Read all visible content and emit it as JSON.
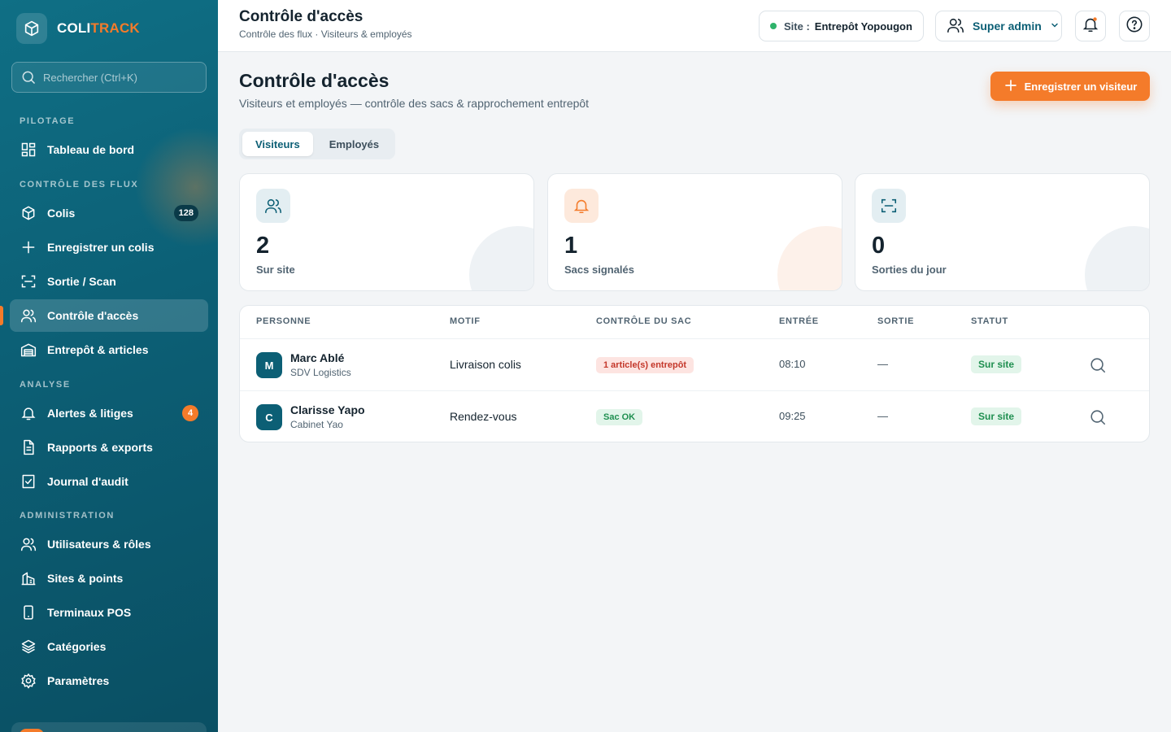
{
  "brand": {
    "part1": "COLI",
    "part2": "TRACK",
    "accent_color": "#f47b2a"
  },
  "search": {
    "placeholder": "Rechercher (Ctrl+K)"
  },
  "sidebar": {
    "sections": [
      "PILOTAGE",
      "CONTRÔLE DES FLUX",
      "ANALYSE",
      "ADMINISTRATION"
    ],
    "items": [
      {
        "label": "Tableau de bord",
        "icon": "dashboard-icon"
      },
      {
        "label": "Colis",
        "icon": "package-icon",
        "badge": "128"
      },
      {
        "label": "Enregistrer un colis",
        "icon": "plus-icon"
      },
      {
        "label": "Sortie / Scan",
        "icon": "scan-icon"
      },
      {
        "label": "Contrôle d'accès",
        "icon": "users-icon",
        "active": true
      },
      {
        "label": "Entrepôt & articles",
        "icon": "warehouse-icon"
      },
      {
        "label": "Alertes & litiges",
        "icon": "bell-icon",
        "badge": "4"
      },
      {
        "label": "Rapports & exports",
        "icon": "document-icon"
      },
      {
        "label": "Journal d'audit",
        "icon": "checklist-icon"
      },
      {
        "label": "Utilisateurs & rôles",
        "icon": "users-icon"
      },
      {
        "label": "Sites & points",
        "icon": "building-icon"
      },
      {
        "label": "Terminaux POS",
        "icon": "device-icon"
      },
      {
        "label": "Catégories",
        "icon": "layers-icon"
      },
      {
        "label": "Paramètres",
        "icon": "gear-icon"
      }
    ]
  },
  "topbar": {
    "title": "Contrôle d'accès",
    "subtitle": "Contrôle des flux · Visiteurs & employés",
    "site_label": "Site :",
    "site_value": "Entrepôt Yopougon",
    "user_role": "Super admin"
  },
  "main": {
    "title": "Contrôle d'accès",
    "subtitle": "Visiteurs et employés — contrôle des sacs & rapprochement entrepôt",
    "primary_action": "Enregistrer un visiteur",
    "tabs": [
      {
        "label": "Visiteurs",
        "active": true
      },
      {
        "label": "Employés",
        "active": false
      }
    ],
    "stats": [
      {
        "value": "2",
        "label": "Sur site",
        "icon": "users-icon"
      },
      {
        "value": "1",
        "label": "Sacs signalés",
        "icon": "bell-icon"
      },
      {
        "value": "0",
        "label": "Sorties du jour",
        "icon": "scan-icon"
      }
    ],
    "table": {
      "headers": [
        "PERSONNE",
        "MOTIF",
        "CONTRÔLE DU SAC",
        "ENTRÉE",
        "SORTIE",
        "STATUT"
      ],
      "rows": [
        {
          "initial": "M",
          "name": "Marc Ablé",
          "org": "SDV Logistics",
          "motif": "Livraison colis",
          "bag_check": "1 article(s) entrepôt",
          "bag_status": "alert",
          "entry": "08:10",
          "exit": "—",
          "status": "Sur site"
        },
        {
          "initial": "C",
          "name": "Clarisse Yapo",
          "org": "Cabinet Yao",
          "motif": "Rendez-vous",
          "bag_check": "Sac OK",
          "bag_status": "ok",
          "entry": "09:25",
          "exit": "—",
          "status": "Sur site"
        }
      ]
    }
  }
}
